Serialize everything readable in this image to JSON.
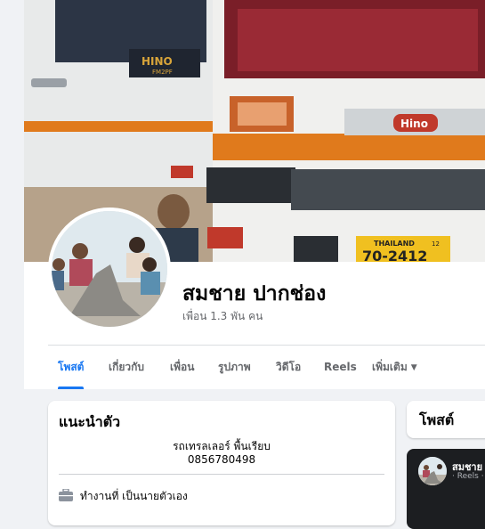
{
  "profile": {
    "name": "สมชาย ปากช่อง",
    "friends": "เพื่อน 1.3 พัน คน"
  },
  "cover": {
    "cab_badge": "HINO",
    "cab_model": "FM2PF",
    "grille_logo": "Hino",
    "plate_country": "THAILAND",
    "plate_number": "70-2412",
    "plate_small": "12"
  },
  "tabs": [
    {
      "label": "โพสต์"
    },
    {
      "label": "เกี่ยวกับ"
    },
    {
      "label": "เพื่อน"
    },
    {
      "label": "รูปภาพ"
    },
    {
      "label": "วิดีโอ"
    },
    {
      "label": "Reels"
    },
    {
      "label": "เพิ่มเติม"
    }
  ],
  "intro": {
    "title": "แนะนำตัว",
    "bio_line1": "รถเทรลเลอร์ พื้นเรียบ",
    "bio_line2": "0856780498",
    "work": "ทำงานที่ เป็นนายตัวเอง"
  },
  "posts": {
    "title": "โพสต์",
    "reel_name": "สมชาย",
    "reel_sub": "· Reels ·"
  },
  "colors": {
    "accent": "#1877f2",
    "text_secondary": "#65676b",
    "page_bg": "#f0f2f5",
    "truck_orange": "#e07a1c"
  },
  "icons": {
    "dropdown": "caret-down-icon",
    "work": "briefcase-icon"
  }
}
